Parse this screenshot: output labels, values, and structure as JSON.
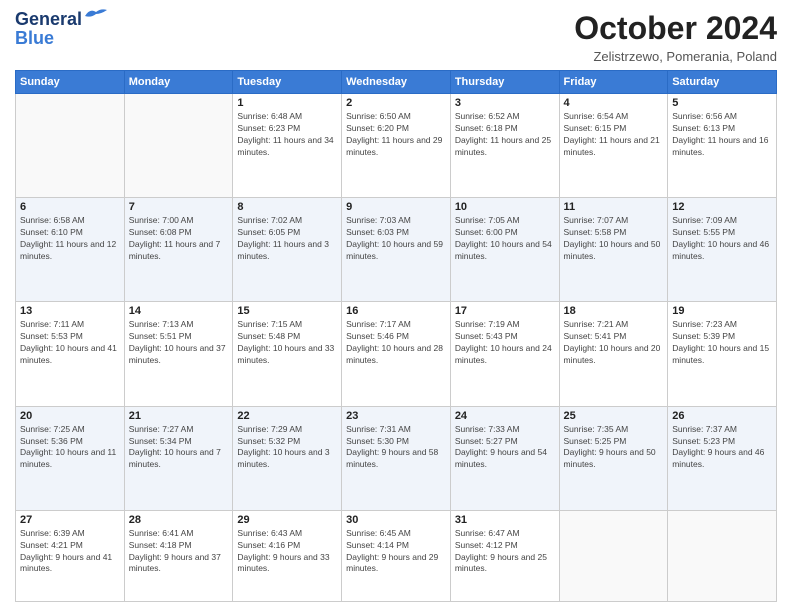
{
  "header": {
    "logo_line1": "General",
    "logo_line2": "Blue",
    "month_year": "October 2024",
    "location": "Zelistrzewo, Pomerania, Poland"
  },
  "weekdays": [
    "Sunday",
    "Monday",
    "Tuesday",
    "Wednesday",
    "Thursday",
    "Friday",
    "Saturday"
  ],
  "weeks": [
    [
      null,
      null,
      {
        "day": 1,
        "sunrise": "6:48 AM",
        "sunset": "6:23 PM",
        "daylight": "11 hours and 34 minutes."
      },
      {
        "day": 2,
        "sunrise": "6:50 AM",
        "sunset": "6:20 PM",
        "daylight": "11 hours and 29 minutes."
      },
      {
        "day": 3,
        "sunrise": "6:52 AM",
        "sunset": "6:18 PM",
        "daylight": "11 hours and 25 minutes."
      },
      {
        "day": 4,
        "sunrise": "6:54 AM",
        "sunset": "6:15 PM",
        "daylight": "11 hours and 21 minutes."
      },
      {
        "day": 5,
        "sunrise": "6:56 AM",
        "sunset": "6:13 PM",
        "daylight": "11 hours and 16 minutes."
      }
    ],
    [
      {
        "day": 6,
        "sunrise": "6:58 AM",
        "sunset": "6:10 PM",
        "daylight": "11 hours and 12 minutes."
      },
      {
        "day": 7,
        "sunrise": "7:00 AM",
        "sunset": "6:08 PM",
        "daylight": "11 hours and 7 minutes."
      },
      {
        "day": 8,
        "sunrise": "7:02 AM",
        "sunset": "6:05 PM",
        "daylight": "11 hours and 3 minutes."
      },
      {
        "day": 9,
        "sunrise": "7:03 AM",
        "sunset": "6:03 PM",
        "daylight": "10 hours and 59 minutes."
      },
      {
        "day": 10,
        "sunrise": "7:05 AM",
        "sunset": "6:00 PM",
        "daylight": "10 hours and 54 minutes."
      },
      {
        "day": 11,
        "sunrise": "7:07 AM",
        "sunset": "5:58 PM",
        "daylight": "10 hours and 50 minutes."
      },
      {
        "day": 12,
        "sunrise": "7:09 AM",
        "sunset": "5:55 PM",
        "daylight": "10 hours and 46 minutes."
      }
    ],
    [
      {
        "day": 13,
        "sunrise": "7:11 AM",
        "sunset": "5:53 PM",
        "daylight": "10 hours and 41 minutes."
      },
      {
        "day": 14,
        "sunrise": "7:13 AM",
        "sunset": "5:51 PM",
        "daylight": "10 hours and 37 minutes."
      },
      {
        "day": 15,
        "sunrise": "7:15 AM",
        "sunset": "5:48 PM",
        "daylight": "10 hours and 33 minutes."
      },
      {
        "day": 16,
        "sunrise": "7:17 AM",
        "sunset": "5:46 PM",
        "daylight": "10 hours and 28 minutes."
      },
      {
        "day": 17,
        "sunrise": "7:19 AM",
        "sunset": "5:43 PM",
        "daylight": "10 hours and 24 minutes."
      },
      {
        "day": 18,
        "sunrise": "7:21 AM",
        "sunset": "5:41 PM",
        "daylight": "10 hours and 20 minutes."
      },
      {
        "day": 19,
        "sunrise": "7:23 AM",
        "sunset": "5:39 PM",
        "daylight": "10 hours and 15 minutes."
      }
    ],
    [
      {
        "day": 20,
        "sunrise": "7:25 AM",
        "sunset": "5:36 PM",
        "daylight": "10 hours and 11 minutes."
      },
      {
        "day": 21,
        "sunrise": "7:27 AM",
        "sunset": "5:34 PM",
        "daylight": "10 hours and 7 minutes."
      },
      {
        "day": 22,
        "sunrise": "7:29 AM",
        "sunset": "5:32 PM",
        "daylight": "10 hours and 3 minutes."
      },
      {
        "day": 23,
        "sunrise": "7:31 AM",
        "sunset": "5:30 PM",
        "daylight": "9 hours and 58 minutes."
      },
      {
        "day": 24,
        "sunrise": "7:33 AM",
        "sunset": "5:27 PM",
        "daylight": "9 hours and 54 minutes."
      },
      {
        "day": 25,
        "sunrise": "7:35 AM",
        "sunset": "5:25 PM",
        "daylight": "9 hours and 50 minutes."
      },
      {
        "day": 26,
        "sunrise": "7:37 AM",
        "sunset": "5:23 PM",
        "daylight": "9 hours and 46 minutes."
      }
    ],
    [
      {
        "day": 27,
        "sunrise": "6:39 AM",
        "sunset": "4:21 PM",
        "daylight": "9 hours and 41 minutes."
      },
      {
        "day": 28,
        "sunrise": "6:41 AM",
        "sunset": "4:18 PM",
        "daylight": "9 hours and 37 minutes."
      },
      {
        "day": 29,
        "sunrise": "6:43 AM",
        "sunset": "4:16 PM",
        "daylight": "9 hours and 33 minutes."
      },
      {
        "day": 30,
        "sunrise": "6:45 AM",
        "sunset": "4:14 PM",
        "daylight": "9 hours and 29 minutes."
      },
      {
        "day": 31,
        "sunrise": "6:47 AM",
        "sunset": "4:12 PM",
        "daylight": "9 hours and 25 minutes."
      },
      null,
      null
    ]
  ]
}
